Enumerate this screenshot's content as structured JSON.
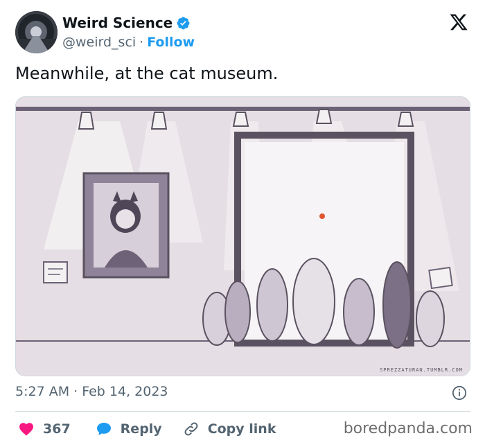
{
  "author": {
    "display_name": "Weird Science",
    "handle": "@weird_sci",
    "separator": "·",
    "follow_label": "Follow",
    "verified": true,
    "verified_color": "#1d9bf0"
  },
  "brand_icon": "x-logo-icon",
  "tweet": {
    "text": "Meanwhile, at the cat museum.",
    "timestamp": "5:27 AM · Feb 14, 2023"
  },
  "media": {
    "credit_text": "SPREZZATURAN.TUMBLR.COM"
  },
  "actions": {
    "like_count": "367",
    "like_color": "#f91880",
    "reply_label": "Reply",
    "reply_color": "#1d9bf0",
    "copy_label": "Copy link"
  },
  "watermark": "boredpanda.com",
  "colors": {
    "link": "#1d9bf0",
    "secondary_text": "#536471"
  }
}
